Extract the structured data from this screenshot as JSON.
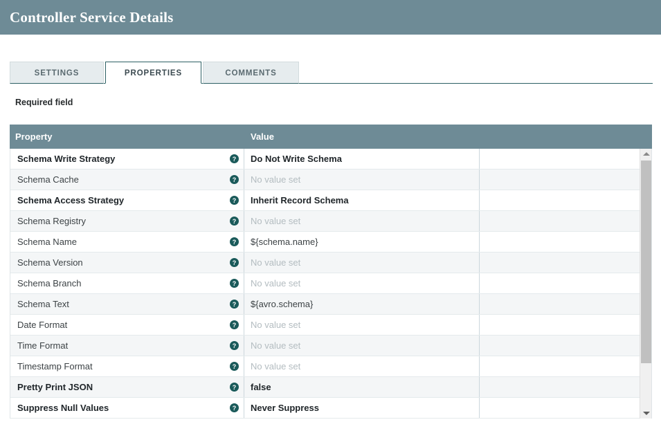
{
  "window": {
    "title": "Controller Service Details"
  },
  "tabs": [
    {
      "label": "SETTINGS",
      "active": false
    },
    {
      "label": "PROPERTIES",
      "active": true
    },
    {
      "label": "COMMENTS",
      "active": false
    }
  ],
  "legend": {
    "required_field_label": "Required field"
  },
  "table": {
    "columns": [
      "Property",
      "Value"
    ],
    "help_icon": "help-circle-icon",
    "unset_placeholder": "No value set",
    "rows": [
      {
        "property": "Schema Write Strategy",
        "value": "Do Not Write Schema",
        "required": true,
        "unset": false
      },
      {
        "property": "Schema Cache",
        "value": "No value set",
        "required": false,
        "unset": true
      },
      {
        "property": "Schema Access Strategy",
        "value": "Inherit Record Schema",
        "required": true,
        "unset": false
      },
      {
        "property": "Schema Registry",
        "value": "No value set",
        "required": false,
        "unset": true
      },
      {
        "property": "Schema Name",
        "value": "${schema.name}",
        "required": false,
        "unset": false
      },
      {
        "property": "Schema Version",
        "value": "No value set",
        "required": false,
        "unset": true
      },
      {
        "property": "Schema Branch",
        "value": "No value set",
        "required": false,
        "unset": true
      },
      {
        "property": "Schema Text",
        "value": "${avro.schema}",
        "required": false,
        "unset": false
      },
      {
        "property": "Date Format",
        "value": "No value set",
        "required": false,
        "unset": true
      },
      {
        "property": "Time Format",
        "value": "No value set",
        "required": false,
        "unset": true
      },
      {
        "property": "Timestamp Format",
        "value": "No value set",
        "required": false,
        "unset": true
      },
      {
        "property": "Pretty Print JSON",
        "value": "false",
        "required": true,
        "unset": false
      },
      {
        "property": "Suppress Null Values",
        "value": "Never Suppress",
        "required": true,
        "unset": false
      }
    ]
  },
  "scrollbar": {
    "up_arrow_icon": "triangle-up-icon",
    "down_arrow_icon": "triangle-down-icon",
    "thumb": "scrollbar-thumb"
  },
  "colors": {
    "header_bar": "#6e8b96",
    "active_tab_border": "#2b5f63",
    "help_icon": "#1a5a5a",
    "row_alt": "#f4f6f7",
    "unset_text": "#b3bcc0"
  }
}
